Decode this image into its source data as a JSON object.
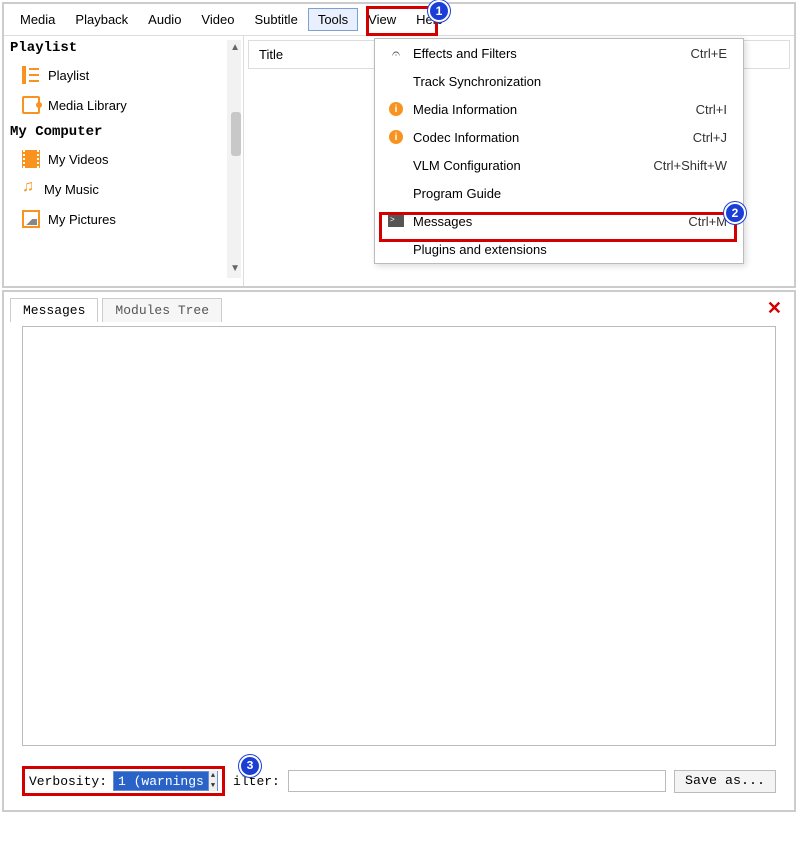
{
  "menubar": {
    "items": [
      "Media",
      "Playback",
      "Audio",
      "Video",
      "Subtitle",
      "Tools",
      "View",
      "Help"
    ],
    "selected_index": 5
  },
  "sidebar": {
    "sections": [
      {
        "title": "Playlist",
        "items": [
          {
            "icon": "playlist-icon",
            "label": "Playlist"
          },
          {
            "icon": "library-icon",
            "label": "Media Library"
          }
        ]
      },
      {
        "title": "My Computer",
        "items": [
          {
            "icon": "video-icon",
            "label": "My Videos"
          },
          {
            "icon": "music-icon",
            "label": "My Music"
          },
          {
            "icon": "pictures-icon",
            "label": "My Pictures"
          }
        ]
      }
    ]
  },
  "playlist_header": "Title",
  "tools_menu": [
    {
      "icon": "sliders-icon",
      "label": "Effects and Filters",
      "shortcut": "Ctrl+E"
    },
    {
      "icon": "",
      "label": "Track Synchronization",
      "shortcut": ""
    },
    {
      "icon": "orange-info-icon",
      "label": "Media Information",
      "shortcut": "Ctrl+I"
    },
    {
      "icon": "orange-info-icon",
      "label": "Codec Information",
      "shortcut": "Ctrl+J"
    },
    {
      "icon": "",
      "label": "VLM Configuration",
      "shortcut": "Ctrl+Shift+W"
    },
    {
      "icon": "",
      "label": "Program Guide",
      "shortcut": ""
    },
    {
      "icon": "terminal-icon",
      "label": "Messages",
      "shortcut": "Ctrl+M"
    },
    {
      "icon": "",
      "label": "Plugins and extensions",
      "shortcut": ""
    }
  ],
  "annotations": {
    "badge1": "1",
    "badge2": "2",
    "badge3": "3"
  },
  "messages_dialog": {
    "tabs": [
      "Messages",
      "Modules Tree"
    ],
    "active_tab": 0,
    "verbosity_label": "Verbosity:",
    "verbosity_value": "1 (warnings",
    "filter_label": "ilter:",
    "filter_value": "",
    "save_button": "Save as..."
  }
}
